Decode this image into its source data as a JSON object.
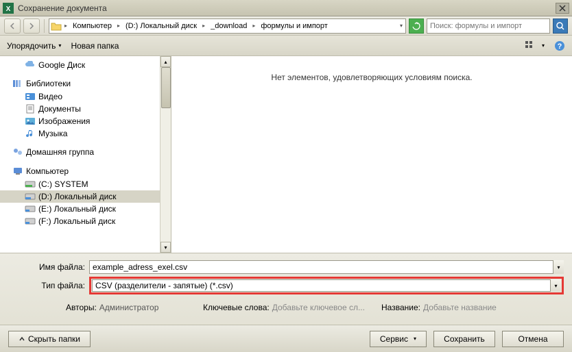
{
  "title": "Сохранение документа",
  "breadcrumb": {
    "parts": [
      "Компьютер",
      "(D:) Локальный диск",
      "_download",
      "формулы и импорт"
    ]
  },
  "search": {
    "placeholder": "Поиск: формулы и импорт"
  },
  "toolbar": {
    "organize": "Упорядочить",
    "new_folder": "Новая папка"
  },
  "tree": {
    "google_disk": "Google Диск",
    "libraries": "Библиотеки",
    "video": "Видео",
    "documents": "Документы",
    "pictures": "Изображения",
    "music": "Музыка",
    "homegroup": "Домашняя группа",
    "computer": "Компьютер",
    "drive_c": "(C:) SYSTEM",
    "drive_d": "(D:) Локальный диск",
    "drive_e": "(E:) Локальный диск",
    "drive_f": "(F:) Локальный диск"
  },
  "content_empty": "Нет элементов, удовлетворяющих условиям поиска.",
  "form": {
    "filename_label": "Имя файла:",
    "filename_value": "example_adress_exel.csv",
    "filetype_label": "Тип файла:",
    "filetype_value": "CSV (разделители - запятые) (*.csv)",
    "authors_label": "Авторы:",
    "authors_value": "Администратор",
    "keywords_label": "Ключевые слова:",
    "keywords_placeholder": "Добавьте ключевое сл...",
    "title_meta_label": "Название:",
    "title_meta_placeholder": "Добавьте название"
  },
  "bottom": {
    "hide_folders": "Скрыть папки",
    "tools": "Сервис",
    "save": "Сохранить",
    "cancel": "Отмена"
  }
}
